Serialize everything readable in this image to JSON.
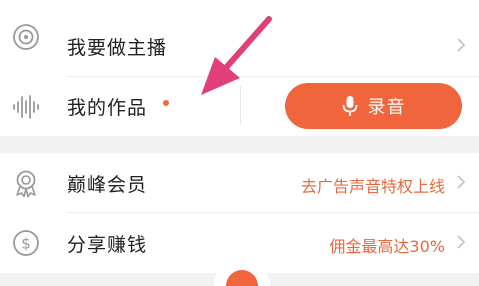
{
  "menu": {
    "broadcast": {
      "label": "我要做主播",
      "icon": "broadcast-icon"
    },
    "my_works": {
      "label": "我的作品",
      "icon": "sound-wave-icon",
      "has_new_dot": true
    },
    "record": {
      "label": "录音",
      "icon": "microphone-icon"
    },
    "vip": {
      "label": "巅峰会员",
      "value": "去广告声音特权上线",
      "icon": "award-ribbon-icon"
    },
    "share": {
      "label": "分享赚钱",
      "value": "佣金最高达30%",
      "icon": "dollar-coin-icon"
    }
  },
  "colors": {
    "accent": "#f0653b",
    "value_text": "#e8693f",
    "annotation_arrow": "#e0407a",
    "background": "#f2f2f2",
    "card": "#ffffff"
  }
}
